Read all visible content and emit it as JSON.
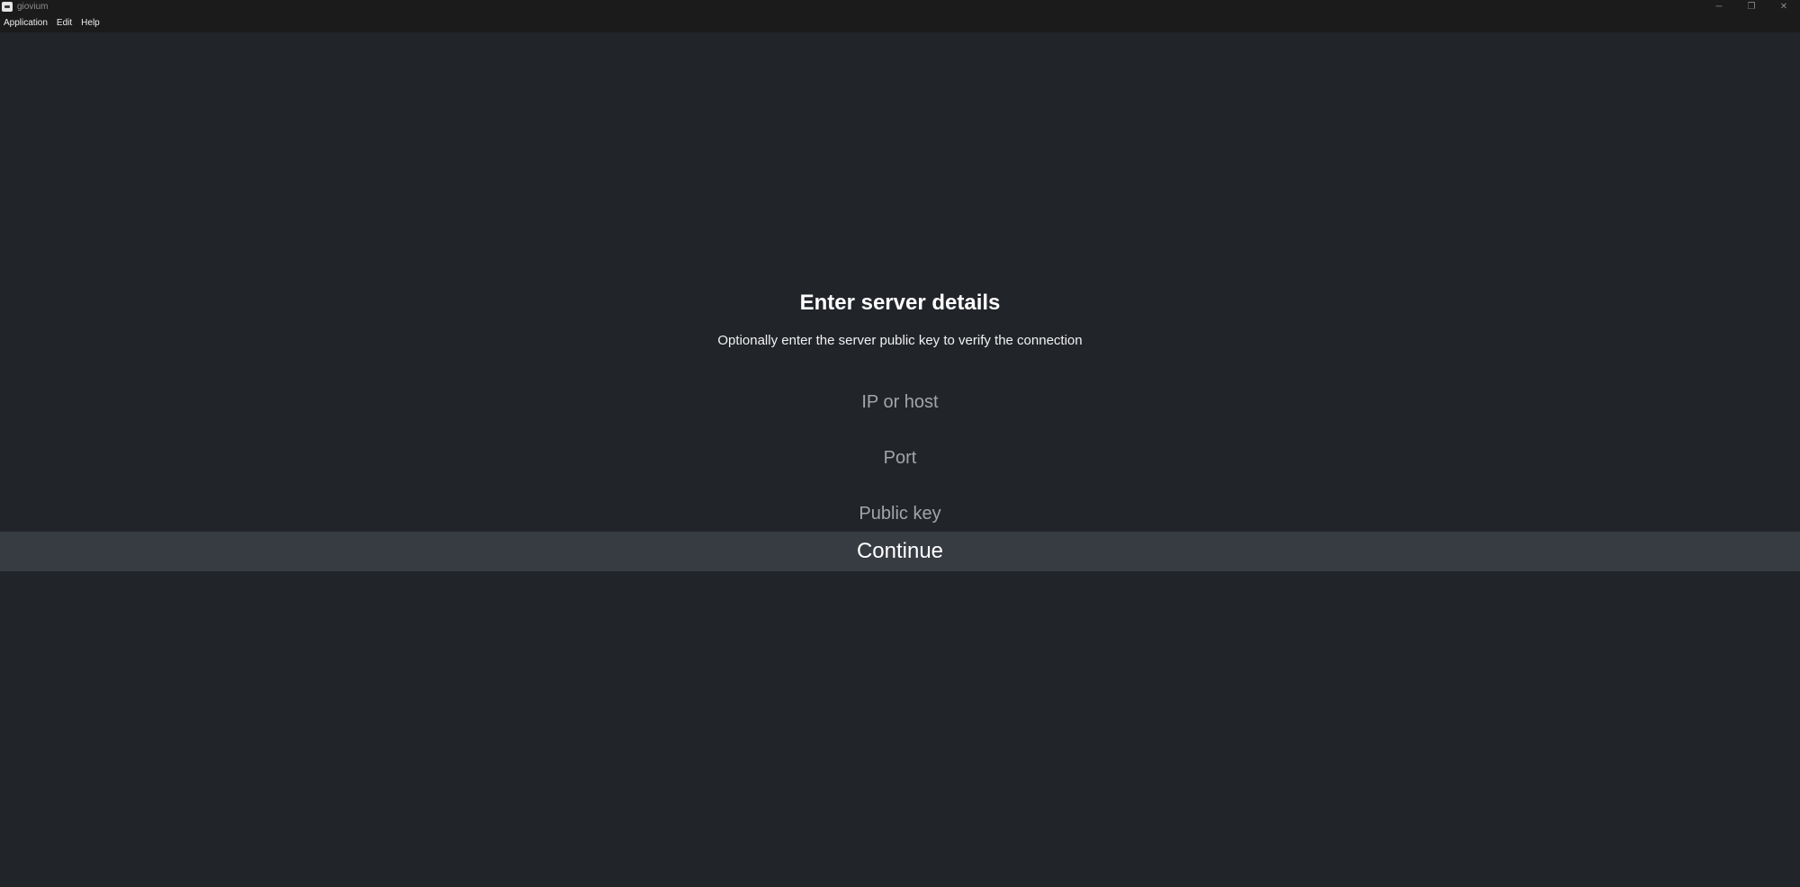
{
  "window": {
    "title": "giovium",
    "controls": {
      "minimize": "─",
      "restore": "❐",
      "close": "✕"
    }
  },
  "menubar": {
    "items": [
      "Application",
      "Edit",
      "Help"
    ]
  },
  "form": {
    "heading": "Enter server details",
    "subheading": "Optionally enter the server public key to verify the connection",
    "host_placeholder": "IP or host",
    "host_value": "",
    "port_placeholder": "Port",
    "port_value": "",
    "key_placeholder": "Public key",
    "key_value": "",
    "continue_label": "Continue"
  },
  "colors": {
    "background": "#212429",
    "titlebar": "#1b1b1b",
    "button_bg": "#373b42",
    "placeholder": "#a3a5a9",
    "text": "#ffffff"
  }
}
